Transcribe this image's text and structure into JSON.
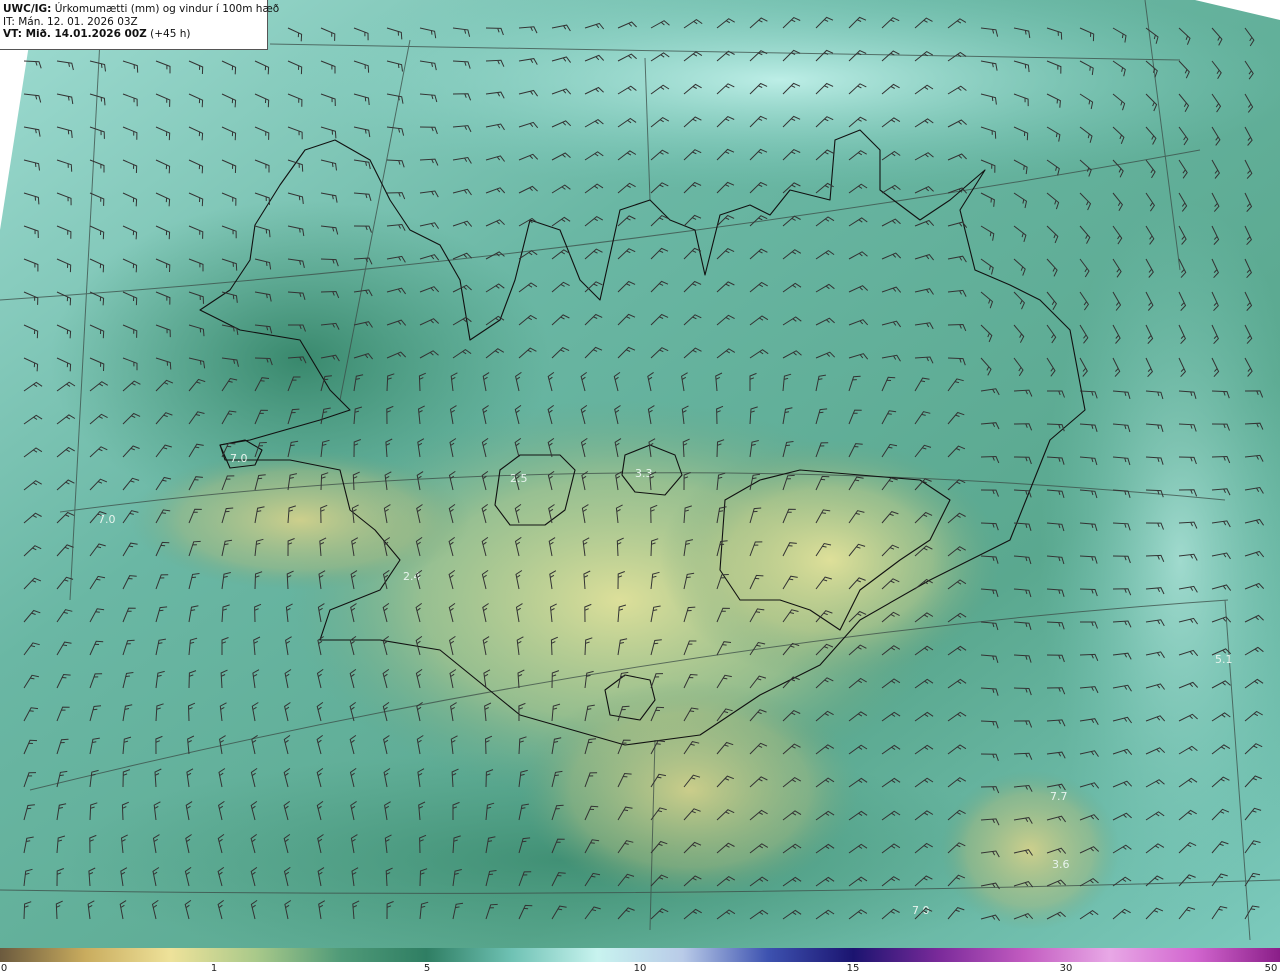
{
  "header": {
    "model": "UWC/IG:",
    "title": "Úrkomumætti (mm) og vindur í 100m hæð",
    "initial_time": "IT: Mán. 12. 01. 2026 03Z",
    "valid_label": "VT: Mið. 14.01.2026 00Z",
    "valid_offset": "(+45 h)"
  },
  "colors": {
    "ocean_high": "#b8eee8",
    "ocean_mid": "#5fb8a8",
    "land_green": "#3e8e6e",
    "dry_yellow": "#d8dc8c",
    "coast_line": "#111111",
    "barb_line": "#333333"
  },
  "value_labels": [
    {
      "text": "7.0"
    },
    {
      "text": "7.0"
    },
    {
      "text": "2.5"
    },
    {
      "text": "3.3"
    },
    {
      "text": "2.4"
    },
    {
      "text": "5.1"
    },
    {
      "text": "7.7"
    },
    {
      "text": "3.6"
    },
    {
      "text": "7.0"
    }
  ],
  "colorbar": {
    "ticks": [
      "0",
      "1",
      "5",
      "10",
      "15",
      "30",
      "50"
    ],
    "stops": [
      {
        "color": "#6b5a3e"
      },
      {
        "color": "#c9ac5e"
      },
      {
        "color": "#eee29a"
      },
      {
        "color": "#a9c98a"
      },
      {
        "color": "#4f9a78"
      },
      {
        "color": "#2f7e63"
      },
      {
        "color": "#6fc2b4"
      },
      {
        "color": "#c8f3ef"
      },
      {
        "color": "#b9cbe8"
      },
      {
        "color": "#3d52b0"
      },
      {
        "color": "#1b1470"
      },
      {
        "color": "#7a2a9a"
      },
      {
        "color": "#c25bc0"
      },
      {
        "color": "#e8a8e6"
      },
      {
        "color": "#d266cf"
      },
      {
        "color": "#8a1e88"
      }
    ]
  }
}
